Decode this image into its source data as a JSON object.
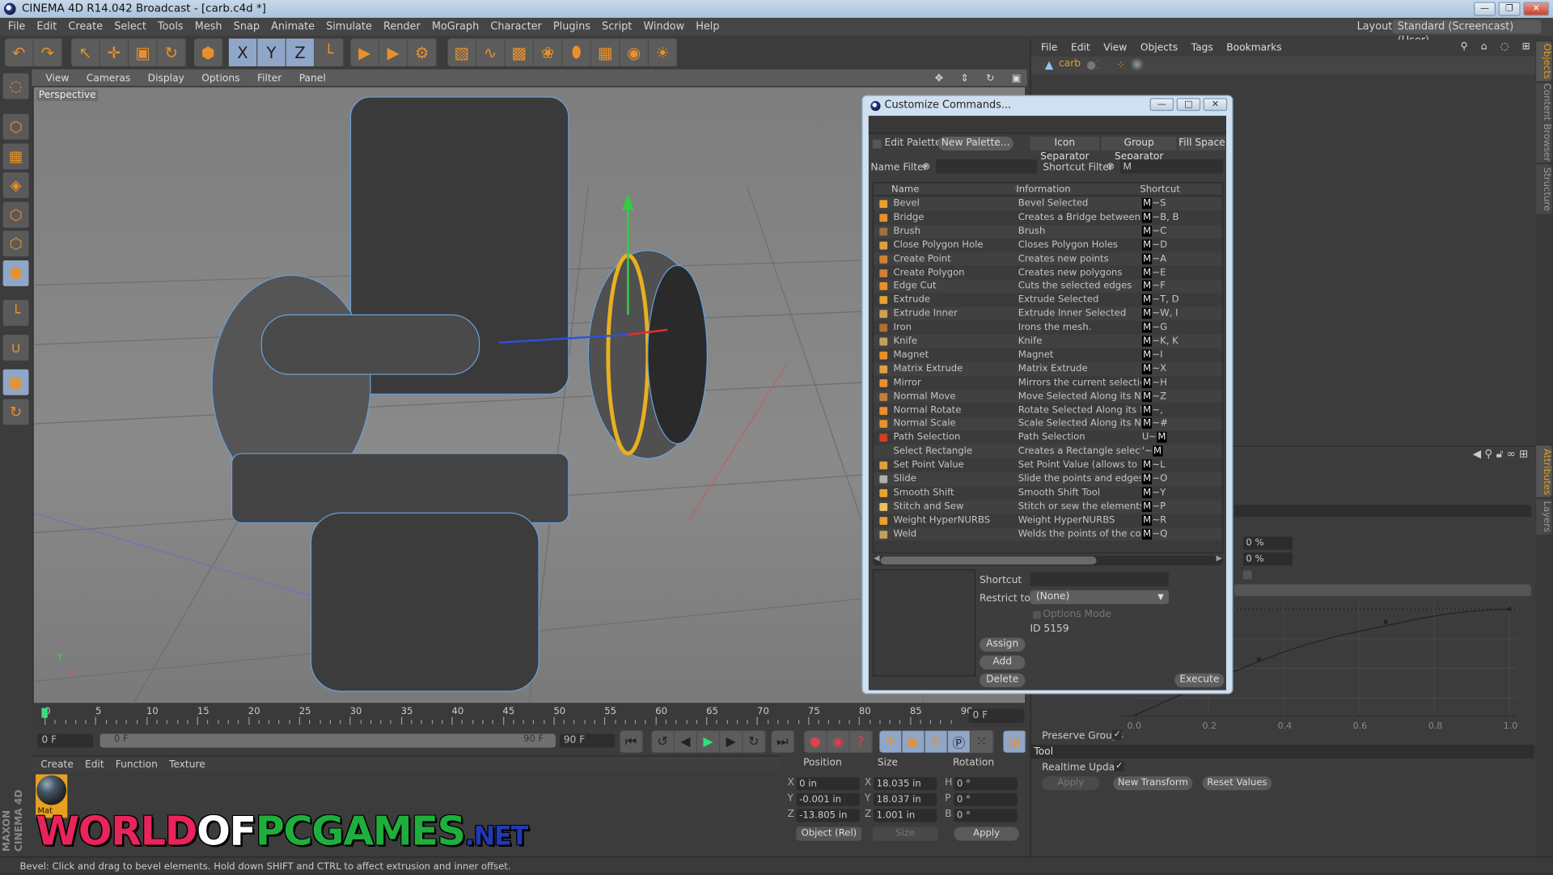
{
  "window": {
    "title": "CINEMA 4D R14.042 Broadcast - [carb.c4d *]",
    "controls": {
      "minimize": "—",
      "restore": "❐",
      "close": "✕"
    }
  },
  "menubar": {
    "items": [
      "File",
      "Edit",
      "Create",
      "Select",
      "Tools",
      "Mesh",
      "Snap",
      "Animate",
      "Simulate",
      "Render",
      "MoGraph",
      "Character",
      "Plugins",
      "Script",
      "Window",
      "Help"
    ],
    "layout_label": "Layout:",
    "layout_value": "Standard (Screencast) (User)"
  },
  "toolbar": {
    "groups": [
      [
        {
          "icon": "undo-icon",
          "glyph": "↶"
        },
        {
          "icon": "redo-icon",
          "glyph": "↷"
        }
      ],
      [
        {
          "icon": "select-arrow-icon",
          "glyph": "↖"
        },
        {
          "icon": "move-icon",
          "glyph": "✛"
        },
        {
          "icon": "scale-icon",
          "glyph": "▣"
        },
        {
          "icon": "rotate-icon",
          "glyph": "↻"
        }
      ],
      [
        {
          "icon": "live-select-icon",
          "glyph": "⬢"
        }
      ],
      [
        {
          "icon": "x-axis-icon",
          "glyph": "X",
          "on": true
        },
        {
          "icon": "y-axis-icon",
          "glyph": "Y",
          "on": true
        },
        {
          "icon": "z-axis-icon",
          "glyph": "Z",
          "on": true
        },
        {
          "icon": "coordinate-system-icon",
          "glyph": "└"
        }
      ],
      [
        {
          "icon": "render-view-icon",
          "glyph": "▶"
        },
        {
          "icon": "render-picture-viewer-icon",
          "glyph": "▶"
        },
        {
          "icon": "render-settings-icon",
          "glyph": "⚙"
        }
      ],
      [
        {
          "icon": "cube-icon",
          "glyph": "▧"
        },
        {
          "icon": "spline-icon",
          "glyph": "∿"
        },
        {
          "icon": "nurbs-icon",
          "glyph": "▩"
        },
        {
          "icon": "array-icon",
          "glyph": "❀"
        },
        {
          "icon": "deformer-icon",
          "glyph": "⬮"
        },
        {
          "icon": "floor-icon",
          "glyph": "▦"
        },
        {
          "icon": "camera-icon",
          "glyph": "◉"
        },
        {
          "icon": "light-icon",
          "glyph": "☀"
        }
      ]
    ]
  },
  "left_tools": [
    {
      "icon": "make-editable-icon",
      "glyph": "◌"
    },
    {
      "icon": "model-mode-icon",
      "glyph": "⬡"
    },
    {
      "icon": "texture-mode-icon",
      "glyph": "▦"
    },
    {
      "icon": "workplane-icon",
      "glyph": "◈"
    },
    {
      "icon": "points-mode-icon",
      "glyph": "⬡"
    },
    {
      "icon": "edges-mode-icon",
      "glyph": "⬡"
    },
    {
      "icon": "polygons-mode-icon",
      "glyph": "⬢",
      "on": true
    },
    {
      "icon": "axis-icon",
      "glyph": "└"
    },
    {
      "icon": "magnet-snap-icon",
      "glyph": "∪"
    },
    {
      "icon": "locked-workplane-icon",
      "glyph": "▦",
      "on": true
    },
    {
      "icon": "planar-workplane-icon",
      "glyph": "↻"
    }
  ],
  "viewport": {
    "menu": [
      "View",
      "Cameras",
      "Display",
      "Options",
      "Filter",
      "Panel"
    ],
    "label": "Perspective",
    "nav_icons": [
      "move-view-icon",
      "zoom-view-icon",
      "rotate-view-icon",
      "maximize-view-icon"
    ],
    "axis_labels": {
      "y": "Y",
      "x": "X"
    }
  },
  "timeline": {
    "ticks": [
      "0",
      "5",
      "10",
      "15",
      "20",
      "25",
      "30",
      "35",
      "40",
      "45",
      "50",
      "55",
      "60",
      "65",
      "70",
      "75",
      "80",
      "85",
      "90"
    ],
    "current_frame_field": "0 F",
    "start_field": "0 F",
    "range_start": "0 F",
    "range_end": "90 F",
    "end_field": "90 F",
    "playhead_frame": 0
  },
  "playback": {
    "buttons": [
      "go-to-start-icon",
      "previous-key-icon",
      "previous-frame-icon",
      "play-icon",
      "next-frame-icon",
      "next-key-icon",
      "go-to-end-icon"
    ],
    "key_buttons": [
      "record-key-icon",
      "autokey-icon",
      "keyframe-selection-icon"
    ],
    "track_buttons": [
      "position-track-icon",
      "scale-track-icon",
      "rotation-track-icon",
      "parameter-track-icon",
      "point-level-icon",
      "timeline-icon"
    ]
  },
  "materials": {
    "menu": [
      "Create",
      "Edit",
      "Function",
      "Texture"
    ],
    "items": [
      {
        "name": "Mat"
      }
    ]
  },
  "coordinates": {
    "headers": {
      "position": "Position",
      "size": "Size",
      "rotation": "Rotation"
    },
    "rows": [
      {
        "pos_axis": "X",
        "pos": "0 in",
        "size_axis": "X",
        "size": "18.035 in",
        "rot_axis": "H",
        "rot": "0 °"
      },
      {
        "pos_axis": "Y",
        "pos": "-0.001 in",
        "size_axis": "Y",
        "size": "18.037 in",
        "rot_axis": "P",
        "rot": "0 °"
      },
      {
        "pos_axis": "Z",
        "pos": "-13.805 in",
        "size_axis": "Z",
        "size": "1.001 in",
        "rot_axis": "B",
        "rot": "0 °"
      }
    ],
    "mode_select": "Object (Rel)",
    "size_select": "Size",
    "apply": "Apply"
  },
  "objects_panel": {
    "menu": [
      "File",
      "Edit",
      "View",
      "Objects",
      "Tags",
      "Bookmarks"
    ],
    "objects": [
      {
        "name": "carb"
      }
    ]
  },
  "side_tabs": {
    "top": [
      "Objects",
      "Content Browser",
      "Structure"
    ],
    "bottom": [
      "Attributes",
      "Layers"
    ]
  },
  "attributes_panel": {
    "fields": [
      "0 %",
      "0 %"
    ],
    "graph_x_ticks": [
      "0.0",
      "0.2",
      "0.4",
      "0.6",
      "0.8",
      "1.0"
    ],
    "preserve_groups_label": "Preserve Groups",
    "preserve_groups_checked": true,
    "tool_section": "Tool",
    "realtime_update_label": "Realtime Update",
    "realtime_update_checked": true,
    "apply": "Apply",
    "new_transform": "New Transform",
    "reset_values": "Reset Values"
  },
  "dialog": {
    "title": "Customize Commands...",
    "edit_palettes": "Edit Palettes",
    "new_palette": "New Palette...",
    "icon_separator": "Icon Separator",
    "group_separator": "Group Separator",
    "fill_space": "Fill Space",
    "name_filter_label": "Name Filter",
    "name_filter_value": "",
    "shortcut_filter_label": "Shortcut Filter",
    "shortcut_filter_value": "M",
    "columns": {
      "name": "Name",
      "info": "Information",
      "shortcut": "Shortcut"
    },
    "commands": [
      {
        "name": "Bevel",
        "info": "Bevel Selected",
        "pre": "",
        "key": "M",
        "post": "~S"
      },
      {
        "name": "Bridge",
        "info": "Creates a Bridge between ob",
        "pre": "",
        "key": "M",
        "post": "~B, B"
      },
      {
        "name": "Brush",
        "info": "Brush",
        "pre": "",
        "key": "M",
        "post": "~C"
      },
      {
        "name": "Close Polygon Hole",
        "info": "Closes Polygon Holes",
        "pre": "",
        "key": "M",
        "post": "~D"
      },
      {
        "name": "Create Point",
        "info": "Creates new points",
        "pre": "",
        "key": "M",
        "post": "~A"
      },
      {
        "name": "Create Polygon",
        "info": "Creates new polygons",
        "pre": "",
        "key": "M",
        "post": "~E"
      },
      {
        "name": "Edge Cut",
        "info": "Cuts the selected edges",
        "pre": "",
        "key": "M",
        "post": "~F"
      },
      {
        "name": "Extrude",
        "info": "Extrude Selected",
        "pre": "",
        "key": "M",
        "post": "~T, D"
      },
      {
        "name": "Extrude Inner",
        "info": "Extrude Inner Selected",
        "pre": "",
        "key": "M",
        "post": "~W, I"
      },
      {
        "name": "Iron",
        "info": "Irons the mesh.",
        "pre": "",
        "key": "M",
        "post": "~G"
      },
      {
        "name": "Knife",
        "info": "Knife",
        "pre": "",
        "key": "M",
        "post": "~K, K"
      },
      {
        "name": "Magnet",
        "info": "Magnet",
        "pre": "",
        "key": "M",
        "post": "~I"
      },
      {
        "name": "Matrix Extrude",
        "info": "Matrix Extrude",
        "pre": "",
        "key": "M",
        "post": "~X"
      },
      {
        "name": "Mirror",
        "info": "Mirrors the current selection",
        "pre": "",
        "key": "M",
        "post": "~H"
      },
      {
        "name": "Normal Move",
        "info": "Move Selected Along its Norm",
        "pre": "",
        "key": "M",
        "post": "~Z"
      },
      {
        "name": "Normal Rotate",
        "info": "Rotate Selected Along its Nor",
        "pre": "",
        "key": "M",
        "post": "~,"
      },
      {
        "name": "Normal Scale",
        "info": "Scale Selected Along its Norm",
        "pre": "",
        "key": "M",
        "post": "~#"
      },
      {
        "name": "Path Selection",
        "info": "Path Selection",
        "pre": "U~",
        "key": "M",
        "post": ""
      },
      {
        "name": "Select Rectangle",
        "info": "Creates a Rectangle selection",
        "pre": "'~",
        "key": "M",
        "post": ""
      },
      {
        "name": "Set Point Value",
        "info": "Set Point Value (allows to Set",
        "pre": "",
        "key": "M",
        "post": "~L"
      },
      {
        "name": "Slide",
        "info": "Slide the points and edges.",
        "pre": "",
        "key": "M",
        "post": "~O"
      },
      {
        "name": "Smooth Shift",
        "info": "Smooth Shift Tool",
        "pre": "",
        "key": "M",
        "post": "~Y"
      },
      {
        "name": "Stitch and Sew",
        "info": "Stitch or sew the elements",
        "pre": "",
        "key": "M",
        "post": "~P"
      },
      {
        "name": "Weight HyperNURBS",
        "info": "Weight HyperNURBS",
        "pre": "",
        "key": "M",
        "post": "~R"
      },
      {
        "name": "Weld",
        "info": "Welds the points of the comp",
        "pre": "",
        "key": "M",
        "post": "~Q"
      }
    ],
    "shortcut_label": "Shortcut",
    "shortcut_value": "",
    "restrict_label": "Restrict to",
    "restrict_value": "(None)",
    "options_mode": "Options Mode",
    "id_text": "ID 5159",
    "assign": "Assign",
    "add": "Add",
    "delete": "Delete",
    "execute": "Execute"
  },
  "statusbar": {
    "text": "Bevel: Click and drag to bevel elements. Hold down SHIFT and CTRL to affect extrusion and inner offset."
  },
  "watermark": {
    "parts": [
      {
        "text": "WORLD",
        "color": "#e8245a"
      },
      {
        "text": "OF",
        "color": "#ffffff"
      },
      {
        "text": "PCGAMES",
        "color": "#1fae3c"
      },
      {
        "text": ".NET",
        "color": "#2038b8"
      }
    ],
    "brand": "MAXON CINEMA 4D"
  },
  "colors": {
    "accent": "#e8902c",
    "selected_tool": "#8fa6c8",
    "panel": "#3c3c3c",
    "playhead": "#3ddc84"
  }
}
